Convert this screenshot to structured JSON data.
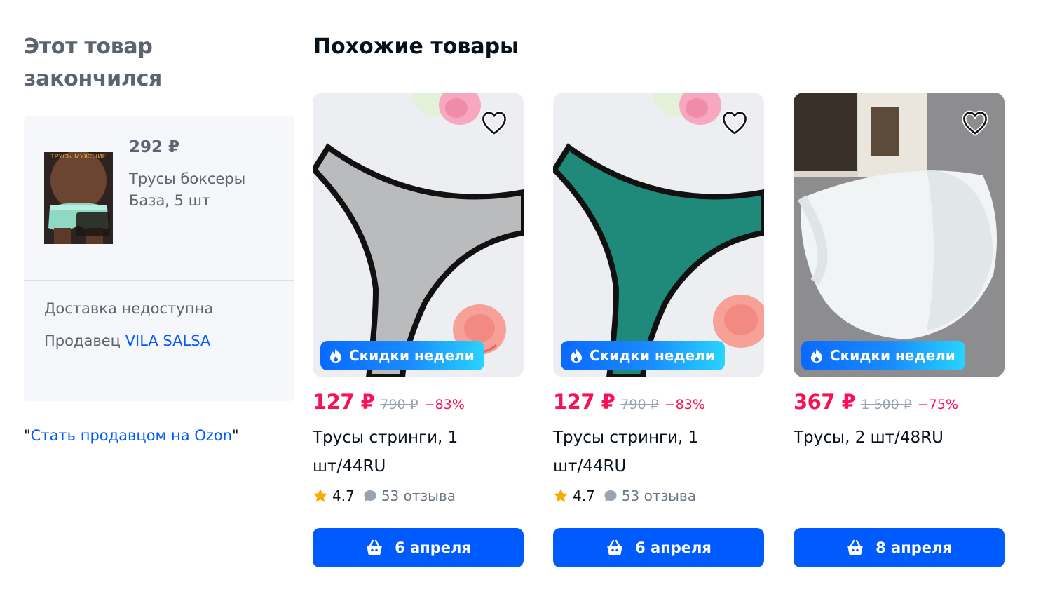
{
  "out_of_stock": {
    "title_line1": "Этот товар",
    "title_line2": "закончился",
    "product": {
      "price": "292 ₽",
      "name_line1": "Трусы боксеры",
      "name_line2": "База, 5 шт",
      "thumb_label": "ТРУСЫ МУЖСКИЕ"
    },
    "delivery": "Доставка недоступна",
    "seller_label": "Продавец",
    "seller_name": "VILA SALSA",
    "become_seller": "Стать продавцом на Ozon"
  },
  "similar": {
    "title": "Похожие товары",
    "badge_label": "Скидки недели",
    "items": [
      {
        "price": "127 ₽",
        "old_price": "790 ₽",
        "discount": "−83%",
        "name": "Трусы стринги, 1 шт/44RU",
        "rating": "4.7",
        "reviews": "53 отзыва",
        "delivery": "6 апреля"
      },
      {
        "price": "127 ₽",
        "old_price": "790 ₽",
        "discount": "−83%",
        "name": "Трусы стринги, 1 шт/44RU",
        "rating": "4.7",
        "reviews": "53 отзыва",
        "delivery": "6 апреля"
      },
      {
        "price": "367 ₽",
        "old_price": "1 500 ₽",
        "discount": "−75%",
        "name": "Трусы, 2 шт/48RU",
        "delivery": "8 апреля"
      }
    ]
  },
  "colors": {
    "accent": "#005bff",
    "price": "#f91155",
    "star": "#ffa800"
  },
  "icons": [
    "heart-icon",
    "fire-icon",
    "star-icon",
    "chat-bubble-icon",
    "basket-icon"
  ]
}
